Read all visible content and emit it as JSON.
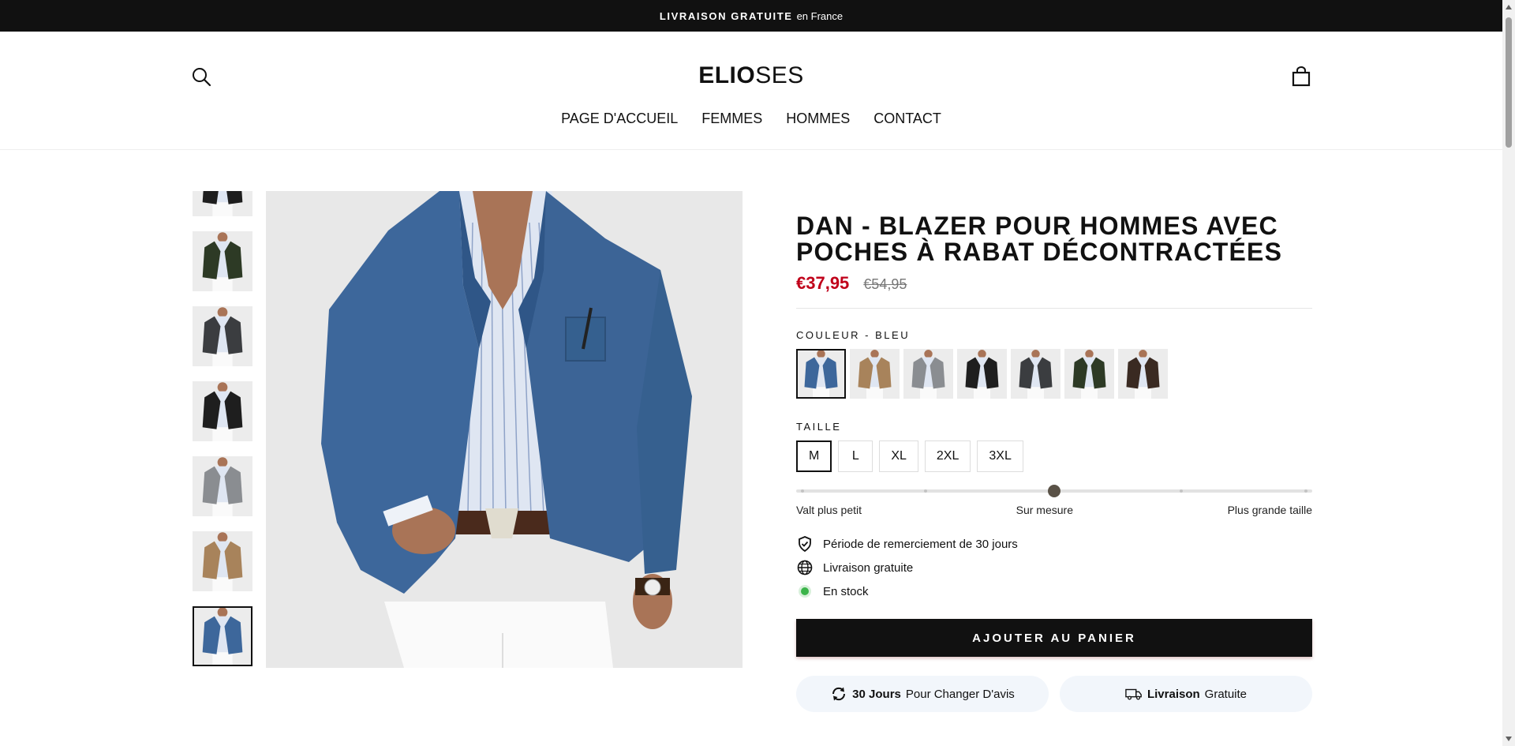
{
  "announcement": {
    "bold": "LIVRAISON GRATUITE",
    "rest": "en France"
  },
  "header": {
    "logo_bold": "ELIO",
    "logo_light": "SES",
    "nav": [
      "PAGE D'ACCUEIL",
      "FEMMES",
      "HOMMES",
      "CONTACT"
    ]
  },
  "colors": {
    "price": "#c0001a",
    "accent_dark": "#111111",
    "stock": "#3bb44a",
    "knob": "#5a5247"
  },
  "product": {
    "title_line1": "DAN - BLAZER POUR HOMMES AVEC",
    "title_line2": "POCHES À RABAT DÉCONTRACTÉES",
    "price": "€37,95",
    "compare_price": "€54,95",
    "color_label": "COULEUR - BLEU",
    "swatches": [
      "bleu",
      "beige",
      "gris clair",
      "noir",
      "gris foncé",
      "vert olive",
      "marron"
    ],
    "size_label": "TAILLE",
    "sizes": [
      "M",
      "L",
      "XL",
      "2XL",
      "3XL"
    ],
    "selected_size": "M",
    "fit": {
      "left": "Valt plus petit",
      "middle": "Sur mesure",
      "right": "Plus grande taille",
      "position": 0.5
    },
    "features": [
      "Période de remerciement de 30 jours",
      "Livraison gratuite",
      "En stock"
    ],
    "add_to_cart": "AJOUTER AU PANIER",
    "pill1_bold": "30 Jours",
    "pill1_rest": "Pour Changer D'avis",
    "pill2_bold": "Livraison",
    "pill2_rest": "Gratuite"
  },
  "icons": [
    "search-icon",
    "cart-icon",
    "shield-check-icon",
    "globe-icon",
    "stock-dot-icon",
    "refresh-icon",
    "truck-icon"
  ]
}
